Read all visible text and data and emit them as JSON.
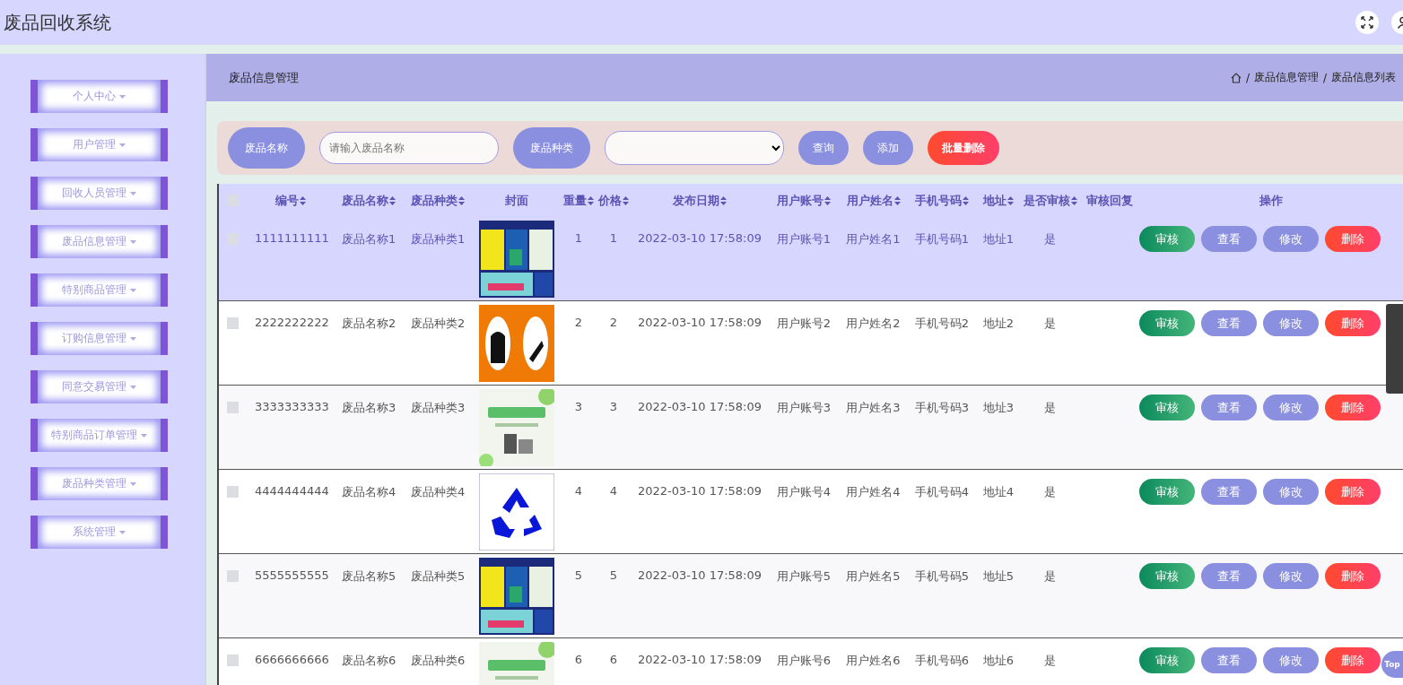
{
  "header": {
    "title": "废品回收系统"
  },
  "sidebar": {
    "items": [
      {
        "label": "个人中心"
      },
      {
        "label": "用户管理"
      },
      {
        "label": "回收人员管理"
      },
      {
        "label": "废品信息管理"
      },
      {
        "label": "特别商品管理"
      },
      {
        "label": "订购信息管理"
      },
      {
        "label": "同意交易管理"
      },
      {
        "label": "特别商品订单管理"
      },
      {
        "label": "废品种类管理"
      },
      {
        "label": "系统管理"
      }
    ]
  },
  "page_header": {
    "title": "废品信息管理",
    "breadcrumb": [
      {
        "separator": "/",
        "label": "废品信息管理"
      },
      {
        "separator": "/",
        "label": "废品信息列表"
      }
    ]
  },
  "search": {
    "name_label": "废品名称",
    "name_placeholder": "请输入废品名称",
    "type_label": "废品种类",
    "buttons": [
      {
        "label": "查询",
        "kind": "primary"
      },
      {
        "label": "添加",
        "kind": "primary"
      },
      {
        "label": "批量删除",
        "kind": "danger"
      }
    ]
  },
  "table": {
    "header_checked": false,
    "columns": [
      {
        "label": "编号",
        "sortable": true
      },
      {
        "label": "废品名称",
        "sortable": true
      },
      {
        "label": "废品种类",
        "sortable": true
      },
      {
        "label": "封面",
        "sortable": false
      },
      {
        "label": "重量",
        "sortable": true
      },
      {
        "label": "价格",
        "sortable": true
      },
      {
        "label": "发布日期",
        "sortable": true
      },
      {
        "label": "用户账号",
        "sortable": true
      },
      {
        "label": "用户姓名",
        "sortable": true
      },
      {
        "label": "手机号码",
        "sortable": true
      },
      {
        "label": "地址",
        "sortable": true
      },
      {
        "label": "是否审核",
        "sortable": true
      },
      {
        "label": "审核回复",
        "sortable": false
      },
      {
        "label": "操作",
        "sortable": false
      }
    ],
    "rows": [
      {
        "selected": true,
        "checked": false,
        "cells": [
          "1111111111",
          "废品名称1",
          "废品种类1",
          {
            "kind": "picture"
          },
          "1",
          "1",
          "2022-03-10 17:58:09",
          "用户账号1",
          "用户姓名1",
          "手机号码1",
          "地址1",
          "是"
        ],
        "actions": [
          {
            "label": "审核",
            "kind": "audit"
          },
          {
            "label": "查看",
            "kind": "view"
          },
          {
            "label": "修改",
            "kind": "edit"
          },
          {
            "label": "删除",
            "kind": "delete"
          }
        ]
      },
      {
        "selected": false,
        "checked": false,
        "cells": [
          "2222222222",
          "废品名称2",
          "废品种类2",
          {
            "kind": "picture"
          },
          "2",
          "2",
          "2022-03-10 17:58:09",
          "用户账号2",
          "用户姓名2",
          "手机号码2",
          "地址2",
          "是"
        ],
        "actions": [
          {
            "label": "审核",
            "kind": "audit"
          },
          {
            "label": "查看",
            "kind": "view"
          },
          {
            "label": "修改",
            "kind": "edit"
          },
          {
            "label": "删除",
            "kind": "delete"
          }
        ]
      },
      {
        "selected": false,
        "checked": false,
        "cells": [
          "3333333333",
          "废品名称3",
          "废品种类3",
          {
            "kind": "picture"
          },
          "3",
          "3",
          "2022-03-10 17:58:09",
          "用户账号3",
          "用户姓名3",
          "手机号码3",
          "地址3",
          "是"
        ],
        "actions": [
          {
            "label": "审核",
            "kind": "audit"
          },
          {
            "label": "查看",
            "kind": "view"
          },
          {
            "label": "修改",
            "kind": "edit"
          },
          {
            "label": "删除",
            "kind": "delete"
          }
        ]
      },
      {
        "selected": false,
        "checked": false,
        "cells": [
          "4444444444",
          "废品名称4",
          "废品种类4",
          {
            "kind": "picture"
          },
          "4",
          "4",
          "2022-03-10 17:58:09",
          "用户账号4",
          "用户姓名4",
          "手机号码4",
          "地址4",
          "是"
        ],
        "actions": [
          {
            "label": "审核",
            "kind": "audit"
          },
          {
            "label": "查看",
            "kind": "view"
          },
          {
            "label": "修改",
            "kind": "edit"
          },
          {
            "label": "删除",
            "kind": "delete"
          }
        ]
      },
      {
        "selected": false,
        "checked": false,
        "cells": [
          "5555555555",
          "废品名称5",
          "废品种类5",
          {
            "kind": "picture"
          },
          "5",
          "5",
          "2022-03-10 17:58:09",
          "用户账号5",
          "用户姓名5",
          "手机号码5",
          "地址5",
          "是"
        ],
        "actions": [
          {
            "label": "审核",
            "kind": "audit"
          },
          {
            "label": "查看",
            "kind": "view"
          },
          {
            "label": "修改",
            "kind": "edit"
          },
          {
            "label": "删除",
            "kind": "delete"
          }
        ]
      },
      {
        "selected": false,
        "checked": false,
        "cells": [
          "6666666666",
          "废品名称6",
          "废品种类6",
          {
            "kind": "picture"
          },
          "6",
          "6",
          "2022-03-10 17:58:09",
          "用户账号6",
          "用户姓名6",
          "手机号码6",
          "地址6",
          "是"
        ],
        "actions": [
          {
            "label": "审核",
            "kind": "audit"
          },
          {
            "label": "查看",
            "kind": "view"
          },
          {
            "label": "修改",
            "kind": "edit"
          },
          {
            "label": "删除",
            "kind": "delete"
          }
        ]
      }
    ]
  },
  "top_button": {
    "label": "Top"
  }
}
